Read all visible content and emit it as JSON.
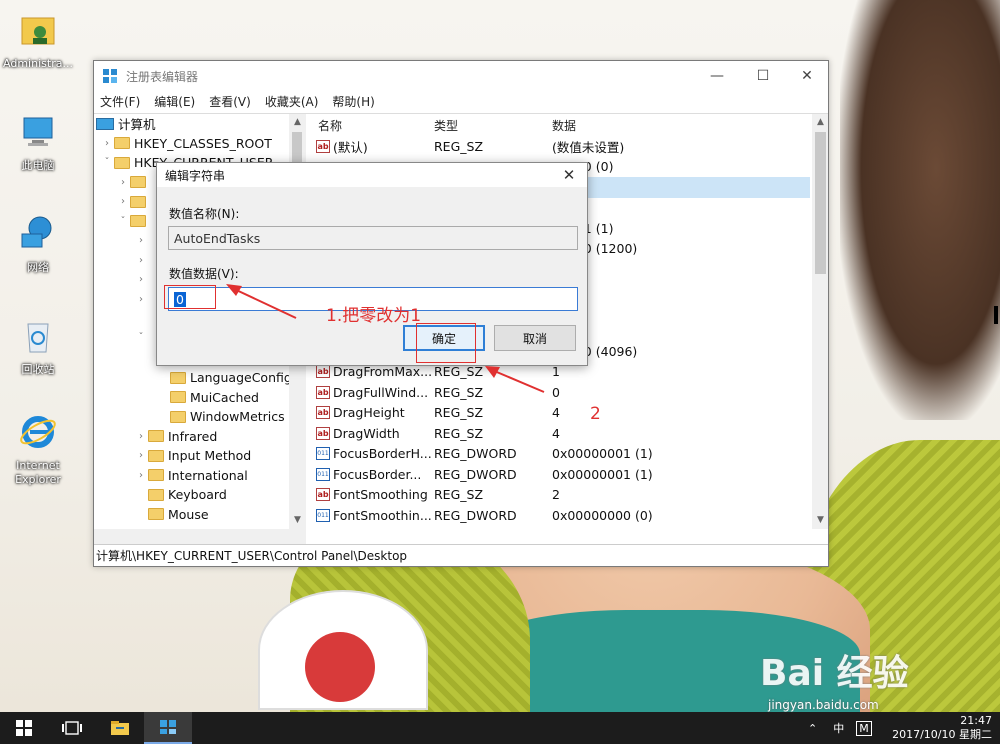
{
  "desktop_icons": [
    {
      "label": "Administra..."
    },
    {
      "label": "此电脑"
    },
    {
      "label": "网络"
    },
    {
      "label": "回收站"
    },
    {
      "label": "Internet Explorer"
    }
  ],
  "window": {
    "title": "注册表编辑器",
    "controls": {
      "minimize": "—",
      "maximize": "☐",
      "close": "✕"
    },
    "menu": [
      "文件(F)",
      "编辑(E)",
      "查看(V)",
      "收藏夹(A)",
      "帮助(H)"
    ]
  },
  "tree": {
    "items": [
      {
        "label": "计算机"
      },
      {
        "label": "HKEY_CLASSES_ROOT"
      },
      {
        "label": "HKEY_CURRENT_USER"
      },
      {
        "label": "LanguageConfigu"
      },
      {
        "label": "MuiCached"
      },
      {
        "label": "WindowMetrics"
      },
      {
        "label": "Infrared"
      },
      {
        "label": "Input Method"
      },
      {
        "label": "International"
      },
      {
        "label": "Keyboard"
      },
      {
        "label": "Mouse"
      }
    ]
  },
  "list": {
    "headers": {
      "name": "名称",
      "type": "类型",
      "data": "数据"
    },
    "rows": [
      {
        "name": "(默认)",
        "type": "REG_SZ",
        "data": "(数值未设置)",
        "kind": "ab"
      },
      {
        "name": "",
        "type": "",
        "data": "00000 (0)",
        "kind": ""
      },
      {
        "name": "",
        "type": "",
        "data": "",
        "kind": ""
      },
      {
        "name": "",
        "type": "",
        "data": "",
        "kind": ""
      },
      {
        "name": "",
        "type": "",
        "data": "00001 (1)",
        "kind": ""
      },
      {
        "name": "",
        "type": "",
        "data": "004b0 (1200)",
        "kind": ""
      },
      {
        "name": "",
        "type": "",
        "data": "",
        "kind": ""
      },
      {
        "name": "",
        "type": "",
        "data": "",
        "kind": ""
      },
      {
        "name": "",
        "type": "",
        "data": "",
        "kind": ""
      },
      {
        "name": "",
        "type": "",
        "data": "",
        "kind": ""
      },
      {
        "name": "",
        "type": "",
        "data": "01000 (4096)",
        "kind": ""
      },
      {
        "name": "DragFromMax...",
        "type": "REG_SZ",
        "data": "1",
        "kind": "ab"
      },
      {
        "name": "DragFullWind...",
        "type": "REG_SZ",
        "data": "0",
        "kind": "ab"
      },
      {
        "name": "DragHeight",
        "type": "REG_SZ",
        "data": "4",
        "kind": "ab"
      },
      {
        "name": "DragWidth",
        "type": "REG_SZ",
        "data": "4",
        "kind": "ab"
      },
      {
        "name": "FocusBorderH...",
        "type": "REG_DWORD",
        "data": "0x00000001 (1)",
        "kind": "bin"
      },
      {
        "name": "FocusBorder...",
        "type": "REG_DWORD",
        "data": "0x00000001 (1)",
        "kind": "bin"
      },
      {
        "name": "FontSmoothing",
        "type": "REG_SZ",
        "data": "2",
        "kind": "ab"
      },
      {
        "name": "FontSmoothin...",
        "type": "REG_DWORD",
        "data": "0x00000000 (0)",
        "kind": "bin"
      }
    ]
  },
  "status_path": "计算机\\HKEY_CURRENT_USER\\Control Panel\\Desktop",
  "dialog": {
    "title": "编辑字符串",
    "close": "✕",
    "name_label": "数值名称(N):",
    "name_value": "AutoEndTasks",
    "data_label": "数值数据(V):",
    "data_value": "0",
    "ok_label": "确定",
    "cancel_label": "取消"
  },
  "annotations": {
    "step1": "1.把零改为1",
    "step2": "2"
  },
  "taskbar": {
    "ime": "中",
    "ime_mode": "M",
    "time": "21:47",
    "date": "2017/10/10 星期二"
  },
  "watermark": {
    "main": "Bai 经验",
    "url": "jingyan.baidu.com"
  },
  "colors": {
    "selection": "#0a64d4",
    "annotation": "#e03030",
    "taskbar": "#1c1c1c"
  }
}
